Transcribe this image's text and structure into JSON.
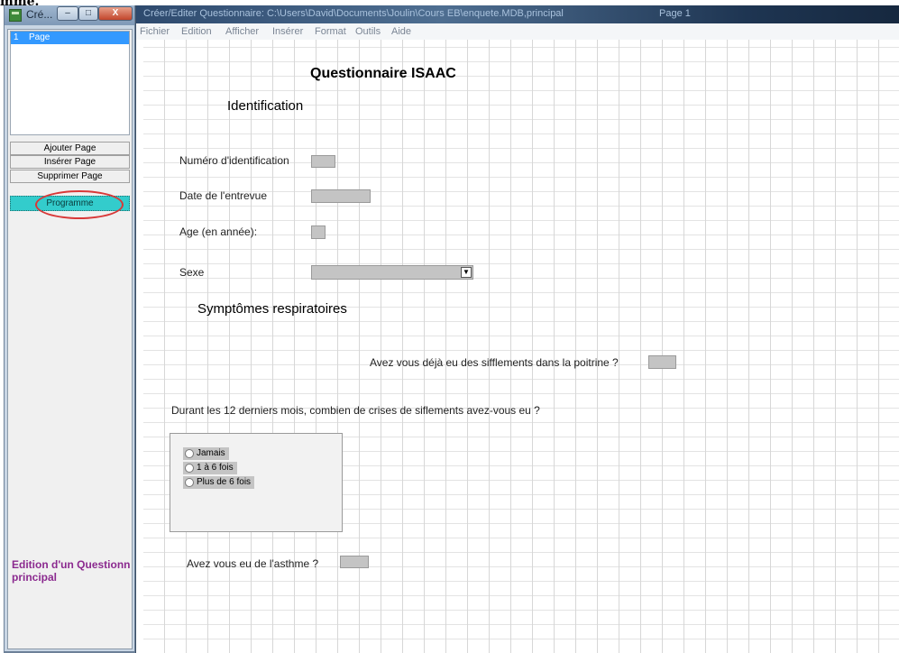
{
  "doc_fragment": "mme.",
  "left_window": {
    "title": "Cré...",
    "controls": {
      "minimize": "‒",
      "maximize": "□",
      "close": "X"
    },
    "page_list": [
      {
        "number": "1",
        "label": "Page"
      }
    ],
    "buttons": {
      "add_page": "Ajouter Page",
      "insert_page": "Insérer Page",
      "delete_page": "Supprimer Page",
      "program": "Programme"
    },
    "status_line1": "Edition d'un Questionn",
    "status_line2": "principal"
  },
  "main_window": {
    "title": "Créer/Editer Questionnaire: C:\\Users\\David\\Documents\\Joulin\\Cours EB\\enquete.MDB,principal",
    "page_label": "Page 1",
    "menu": [
      "Fichier",
      "Edition",
      "Afficher",
      "Insérer",
      "Format",
      "Outils",
      "Aide"
    ]
  },
  "form": {
    "title": "Questionnaire ISAAC",
    "section_identification": "Identification",
    "label_num": "Numéro d'identification",
    "label_date": "Date de l'entrevue",
    "label_age": "Age (en année):",
    "label_sexe": "Sexe",
    "section_symptomes": "Symptômes respiratoires",
    "label_sifflements": "Avez vous déjà eu des sifflements dans la poitrine ?",
    "label_crises": "Durant les 12 derniers mois, combien de crises de siflements avez-vous eu ?",
    "options": [
      "Jamais",
      "1 à 6 fois",
      "Plus de 6 fois"
    ],
    "label_asthme": "Avez vous eu de l'asthme ?"
  }
}
